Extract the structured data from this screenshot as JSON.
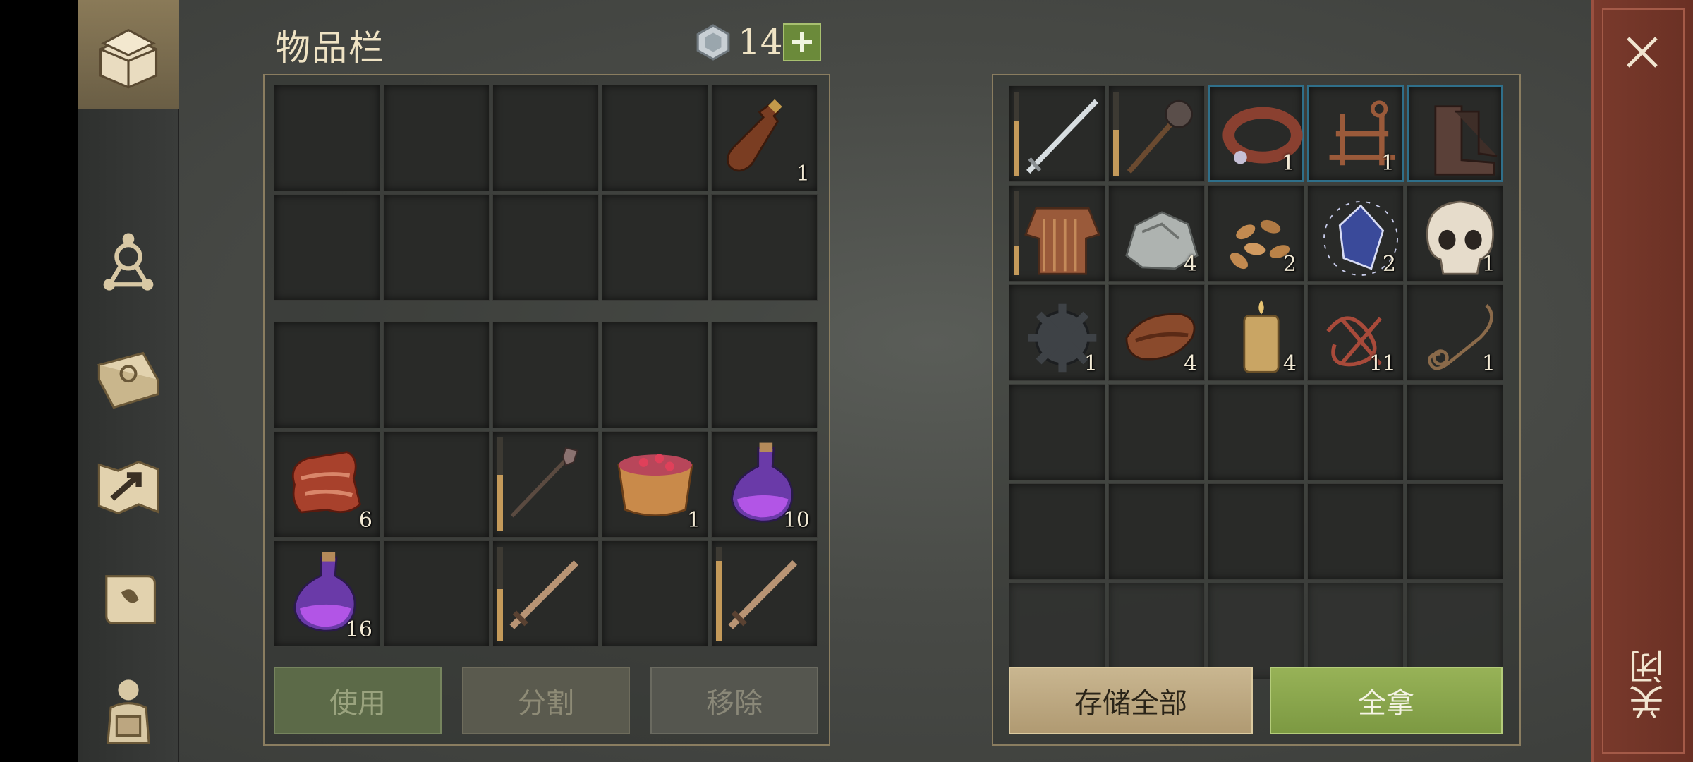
{
  "inventory": {
    "title": "物品栏",
    "currency": "14",
    "top_grid": [
      {},
      {},
      {},
      {},
      {
        "icon": "leather-flask-icon",
        "count": "1"
      },
      {},
      {},
      {},
      {},
      {}
    ],
    "bottom_grid": [
      {},
      {},
      {},
      {},
      {},
      {
        "icon": "raw-meat-icon",
        "count": "6"
      },
      {},
      {
        "icon": "spear-icon",
        "durability": 0.6
      },
      {
        "icon": "berry-bowl-icon",
        "count": "1"
      },
      {
        "icon": "purple-potion-icon",
        "count": "10"
      },
      {
        "icon": "purple-potion-icon",
        "count": "16"
      },
      {},
      {
        "icon": "wooden-sword-icon",
        "durability": 0.55
      },
      {},
      {
        "icon": "wooden-sword-icon",
        "durability": 0.85
      }
    ],
    "buttons": {
      "use": "使用",
      "split": "分割",
      "remove": "移除"
    }
  },
  "storage": {
    "slots": [
      {
        "icon": "steel-sword-icon",
        "durability": 0.65
      },
      {
        "icon": "mace-icon",
        "durability": 0.55
      },
      {
        "icon": "collar-icon",
        "count": "1",
        "highlight": true
      },
      {
        "icon": "trap-icon",
        "count": "1",
        "highlight": true
      },
      {
        "icon": "boots-icon",
        "highlight": true
      },
      {
        "icon": "chainmail-icon",
        "durability": 0.35
      },
      {
        "icon": "stone-icon",
        "count": "4"
      },
      {
        "icon": "seeds-icon",
        "count": "2"
      },
      {
        "icon": "crystal-icon",
        "count": "2"
      },
      {
        "icon": "skull-icon",
        "count": "1"
      },
      {
        "icon": "gear-part-icon",
        "count": "1"
      },
      {
        "icon": "leather-icon",
        "count": "4"
      },
      {
        "icon": "candle-icon",
        "count": "4"
      },
      {
        "icon": "red-fiber-icon",
        "count": "11"
      },
      {
        "icon": "rope-icon",
        "count": "1"
      },
      {},
      {},
      {},
      {},
      {},
      {},
      {},
      {},
      {},
      {},
      {},
      {},
      {},
      {},
      {}
    ],
    "buttons": {
      "store_all": "存储全部",
      "take_all": "全拿"
    }
  },
  "close": {
    "label": "关闭"
  },
  "sidebar": {
    "tabs": [
      "chest-icon",
      "crafting-icon",
      "journal-icon",
      "map-icon",
      "scroll-icon",
      "character-icon"
    ]
  }
}
